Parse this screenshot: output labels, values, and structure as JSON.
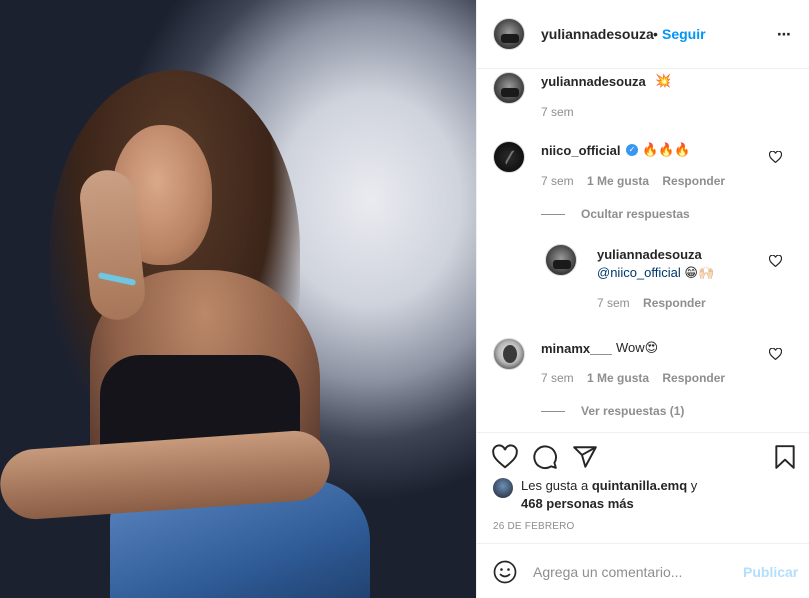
{
  "post": {
    "author": "yuliannadesouza",
    "follow_label": "Seguir",
    "separator": "•",
    "more_label": "•••"
  },
  "caption": {
    "user": "yuliannadesouza",
    "text": "💥",
    "time": "7 sem"
  },
  "comments": [
    {
      "user": "niico_official",
      "verified": true,
      "text": "🔥🔥🔥",
      "time": "7 sem",
      "likes": "1 Me gusta",
      "reply_label": "Responder",
      "thread_toggle": "Ocultar respuestas",
      "replies": [
        {
          "user": "yuliannadesouza",
          "mention": "@niico_official",
          "text": " 😁🙌🏻",
          "time": "7 sem",
          "reply_label": "Responder"
        }
      ]
    },
    {
      "user": "minamx___",
      "text": "Wow😍",
      "time": "7 sem",
      "likes": "1 Me gusta",
      "reply_label": "Responder",
      "thread_toggle": "Ver respuestas (1)"
    }
  ],
  "likes": {
    "prefix": "Les gusta a ",
    "user": "quintanilla.emq",
    "joiner": " y",
    "others": "468 personas más"
  },
  "date": "26 DE FEBRERO",
  "add_comment": {
    "placeholder": "Agrega un comentario...",
    "post_label": "Publicar"
  },
  "icons": [
    "heart-icon",
    "comment-icon",
    "share-icon",
    "bookmark-icon",
    "emoji-icon",
    "verified-icon",
    "more-icon"
  ],
  "colors": {
    "link_blue": "#0095f6",
    "verified_blue": "#3897f0",
    "muted": "#8e8e8e",
    "post_disabled": "#b2dffc"
  }
}
